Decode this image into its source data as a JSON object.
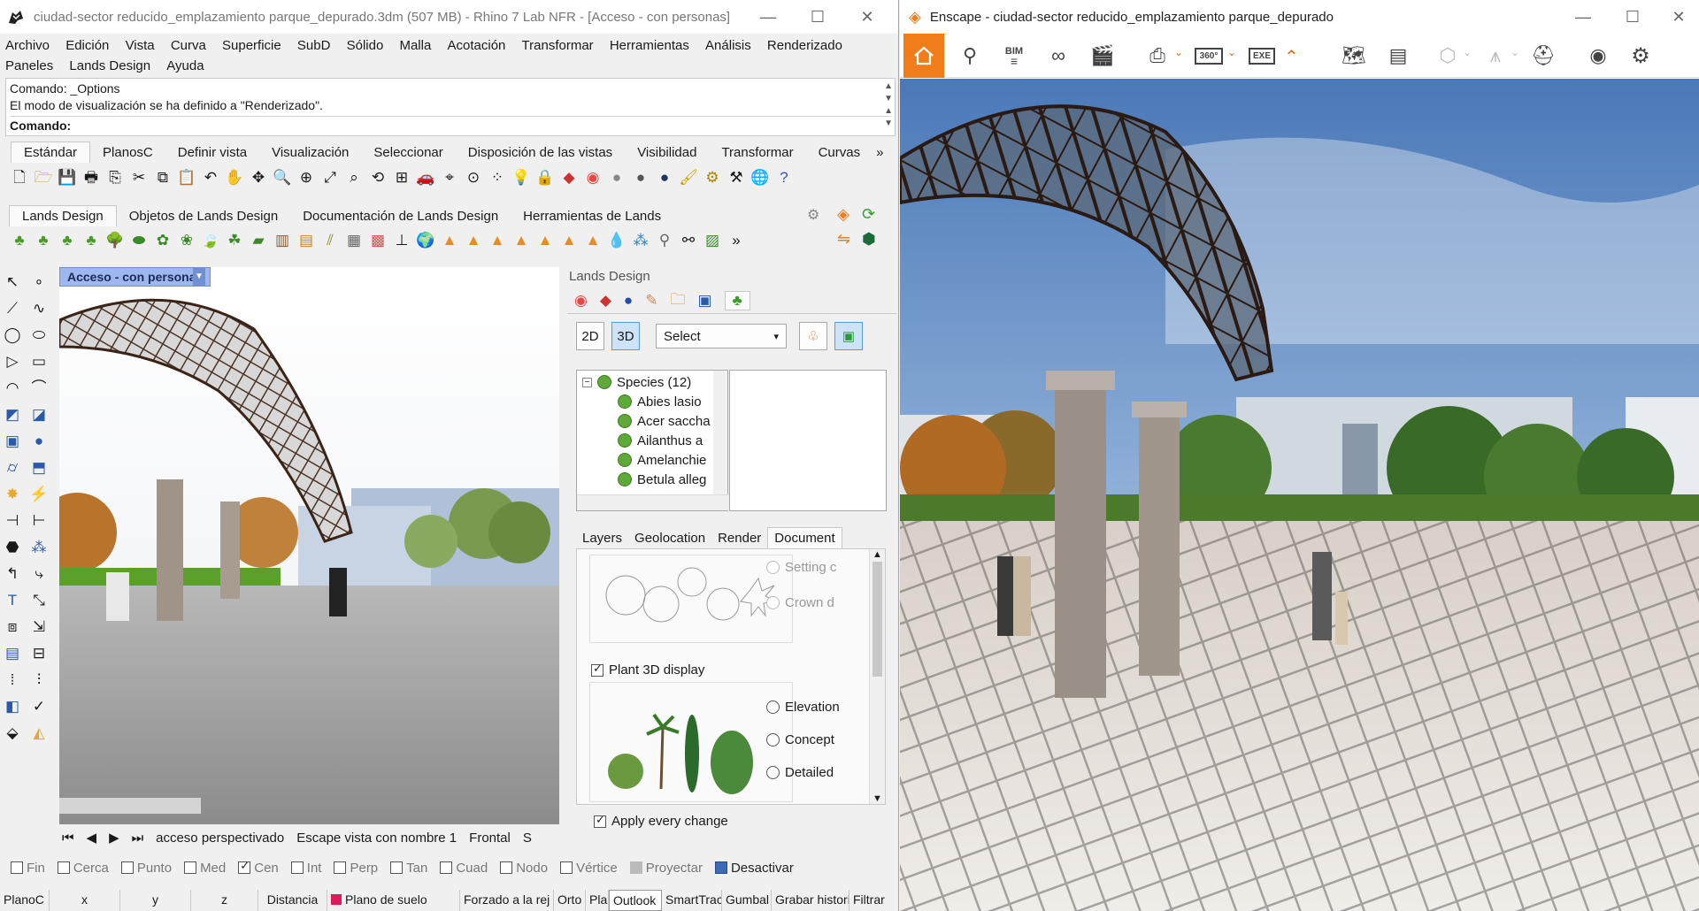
{
  "rhino": {
    "title": "ciudad-sector reducido_emplazamiento parque_depurado.3dm (507 MB) - Rhino 7 Lab NFR - [Acceso - con personas]",
    "menu": [
      "Archivo",
      "Edición",
      "Vista",
      "Curva",
      "Superficie",
      "SubD",
      "Sólido",
      "Malla",
      "Acotación",
      "Transformar",
      "Herramientas",
      "Análisis",
      "Renderizado",
      "Paneles",
      "Lands Design",
      "Ayuda"
    ],
    "command": {
      "history1": "Comando: _Options",
      "history2": "El modo de visualización se ha definido a \"Renderizado\".",
      "prompt": "Comando:"
    },
    "toolbar_tabs": [
      "Estándar",
      "PlanosC",
      "Definir vista",
      "Visualización",
      "Seleccionar",
      "Disposición de las vistas",
      "Visibilidad",
      "Transformar",
      "Curvas"
    ],
    "lands_tabs": [
      "Lands Design",
      "Objetos de Lands Design",
      "Documentación de Lands Design",
      "Herramientas de Lands"
    ],
    "viewport_title": "Acceso - con personas",
    "view_tabs": [
      "acceso perspectivado",
      "Escape vista con nombre 1",
      "Frontal",
      "S"
    ],
    "panel": {
      "title": "Lands Design",
      "btn_2d": "2D",
      "btn_3d": "3D",
      "select_value": "Select",
      "species_root": "Species (12)",
      "species": [
        "Abies lasio",
        "Acer saccha",
        "Ailanthus a",
        "Amelanchie",
        "Betula alleg"
      ],
      "tabs": [
        "Layers",
        "Geolocation",
        "Render",
        "Document"
      ],
      "setting_label": "Setting c",
      "crown_label": "Crown d",
      "plant3d_label": "Plant 3D display",
      "opt_elevation": "Elevation",
      "opt_concept": "Concept",
      "opt_detailed": "Detailed",
      "apply_label": "Apply every change"
    },
    "snaps": [
      "Fin",
      "Cerca",
      "Punto",
      "Med",
      "Cen",
      "Int",
      "Perp",
      "Tan",
      "Cuad",
      "Nodo",
      "Vértice",
      "Proyectar",
      "Desactivar"
    ],
    "status": [
      "PlanoC",
      "x",
      "y",
      "z",
      "Distancia",
      "Plano de suelo",
      "Forzado a la rej",
      "Orto",
      "Plan",
      "Outlook",
      "SmartTrack",
      "Gumbal",
      "Grabar historia",
      "Filtrar"
    ]
  },
  "enscape": {
    "title": "Enscape - ciudad-sector reducido_emplazamiento parque_depurado",
    "accent": "#f07d1a",
    "toolbar_icons": [
      "home-icon",
      "pin-icon",
      "bim-icon",
      "binoculars-icon",
      "clapper-icon",
      "export-image-icon",
      "panorama-360-icon",
      "exe-export-icon",
      "collapse-icon",
      "map-icon",
      "sheet-icon",
      "cube-icon",
      "asset-icon",
      "hat-icon",
      "eye-icon",
      "gear-icon"
    ],
    "bim_label": "BIM",
    "pano_label": "360°",
    "exe_label": "EXE"
  }
}
